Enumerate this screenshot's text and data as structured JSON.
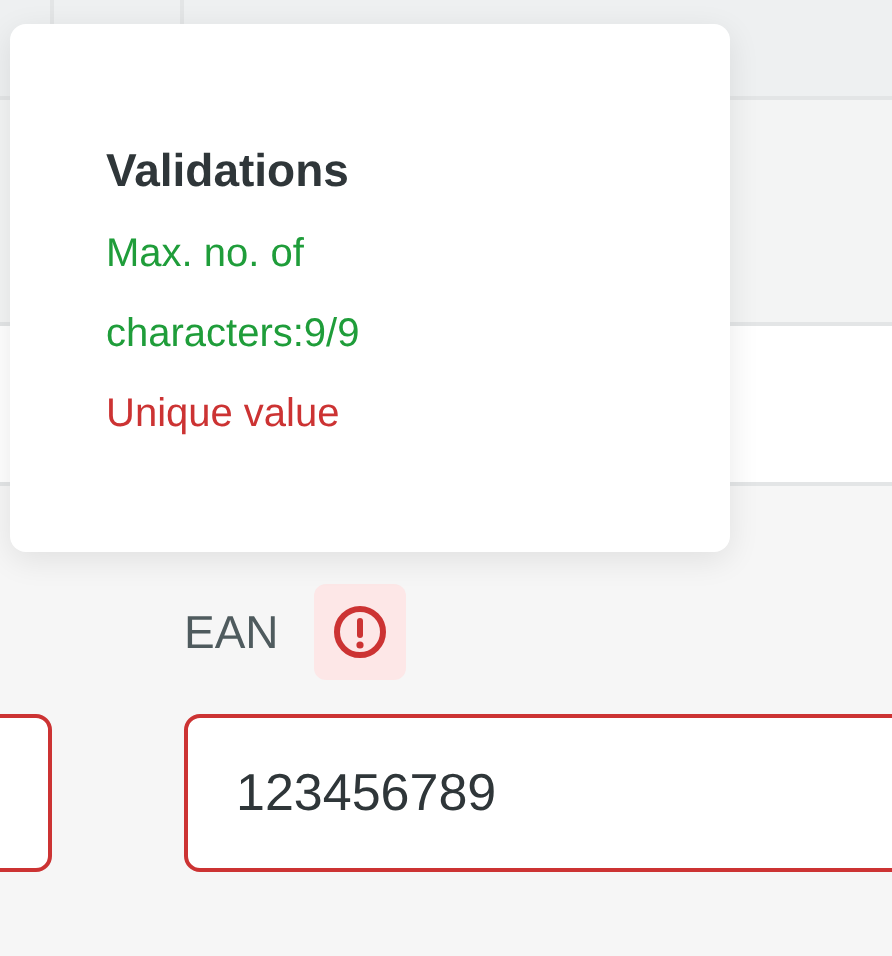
{
  "popover": {
    "title": "Validations",
    "rules": [
      {
        "text": "Max. no. of characters:9/9",
        "passed": true
      },
      {
        "text": "Unique value",
        "passed": false
      }
    ]
  },
  "fields": [
    {
      "invalid": true
    },
    {
      "label": "EAN",
      "value": "123456789",
      "invalid": true
    }
  ]
}
